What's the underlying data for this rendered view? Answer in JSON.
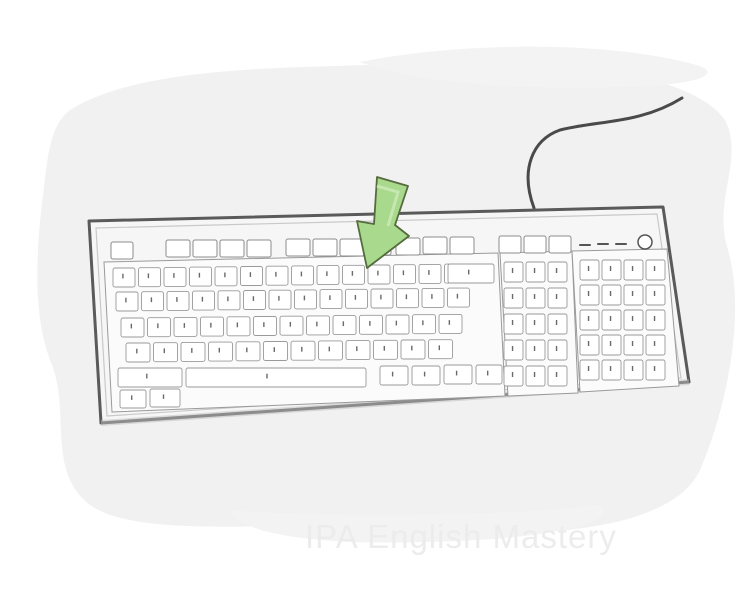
{
  "watermark": {
    "text": "IPA English Mastery"
  },
  "illustration": {
    "subject": "keyboard",
    "pointer_icon": "arrow-down-icon",
    "colors": {
      "background_blob": "#f1f1f1",
      "keyboard_body": "#f7f7f7",
      "key_face": "#ffffff",
      "outline": "#5e5e5e",
      "arrow": "#a9d98d",
      "arrow_outline": "#556b3e",
      "watermark": "#ececec"
    }
  }
}
